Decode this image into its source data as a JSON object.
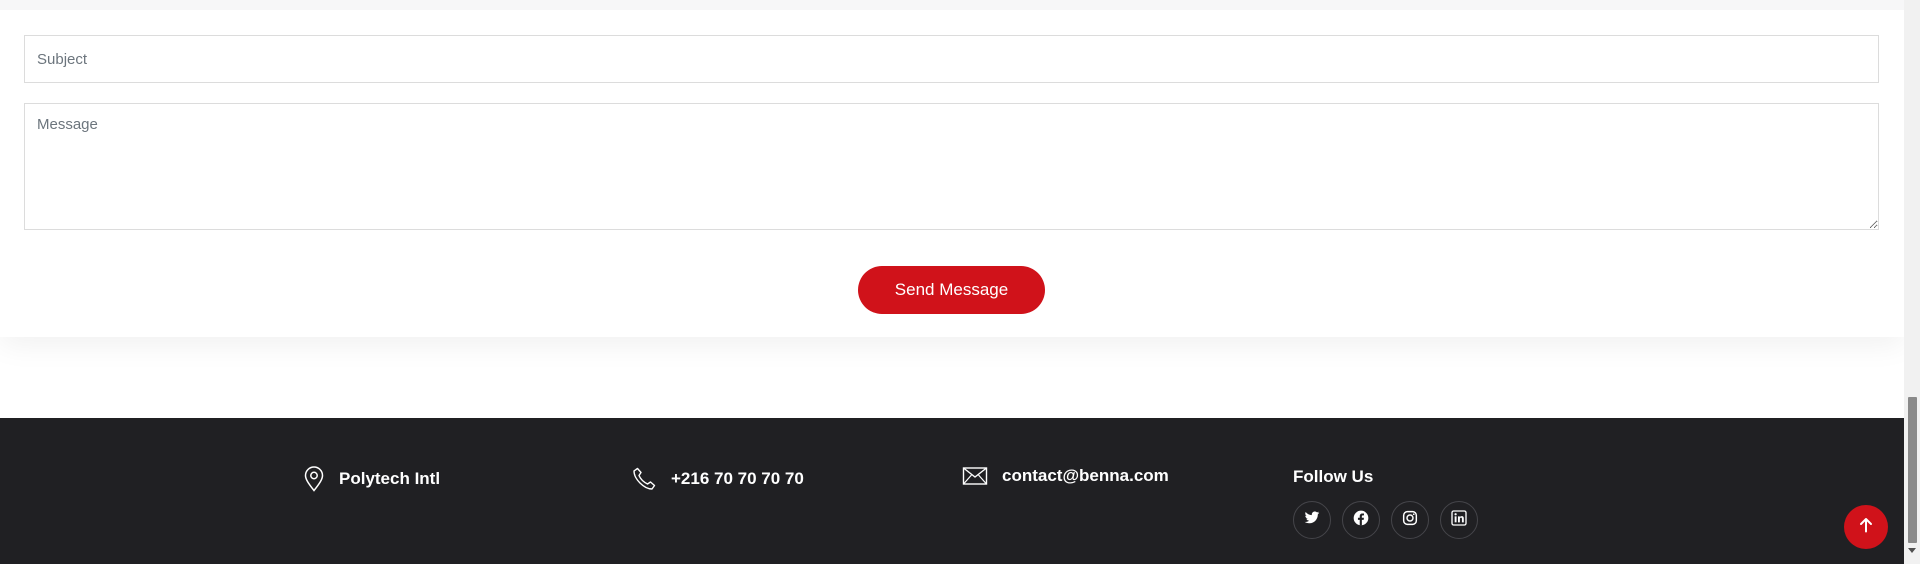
{
  "form": {
    "subject_placeholder": "Subject",
    "message_placeholder": "Message",
    "send_label": "Send Message"
  },
  "footer": {
    "address": "Polytech Intl",
    "phone": "+216 70 70 70 70",
    "email": "contact@benna.com",
    "follow_title": "Follow Us",
    "socials": [
      {
        "name": "twitter-icon"
      },
      {
        "name": "facebook-icon"
      },
      {
        "name": "instagram-icon"
      },
      {
        "name": "linkedin-icon"
      }
    ]
  },
  "colors": {
    "accent": "#d0121a",
    "footer_bg": "#202023",
    "footer_text": "#ffffff"
  }
}
